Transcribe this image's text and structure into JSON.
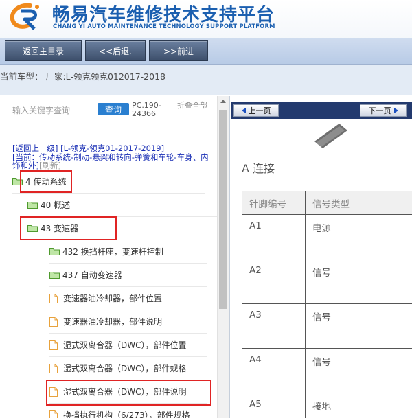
{
  "header": {
    "title_cn": "畅易汽车维修技术支持平台",
    "title_en": "CHANG YI AUTO MAINTENANCE TECHNOLOGY SUPPORT PLATFORM"
  },
  "toolbar": {
    "home_label": "返回主目录",
    "back_label": "<<后退.",
    "forward_label": ">>前进"
  },
  "current_model": "当前车型：  厂家:L-领克领克012017-2018",
  "sidebar": {
    "search_placeholder": "输入关键字查询",
    "search_button": "查询",
    "pc_code": "PC.190-24366",
    "collapse_all": "折叠全部",
    "back_up_link": "[返回上一级]",
    "back_up_model": "[L-领克-领克01-2017-2019]",
    "current_path": "[当前：传动系统-制动-悬架和转向-弹簧和车轮-车身、内饰和外]",
    "refresh": "[刷新]",
    "tree": [
      {
        "label": "4 传动系统",
        "type": "folder"
      },
      {
        "label": "40 概述",
        "type": "folder"
      },
      {
        "label": "43 变速器",
        "type": "folder"
      },
      {
        "label": "432 换挡杆座，变速杆控制",
        "type": "folder"
      },
      {
        "label": "437 自动变速器",
        "type": "folder"
      },
      {
        "label": "变速器油冷却器，部件位置",
        "type": "doc"
      },
      {
        "label": "变速器油冷却器，部件说明",
        "type": "doc"
      },
      {
        "label": "湿式双离合器（DWC），部件位置",
        "type": "doc"
      },
      {
        "label": "湿式双离合器（DWC），部件规格",
        "type": "doc"
      },
      {
        "label": "湿式双离合器（DWC），部件说明",
        "type": "doc"
      },
      {
        "label": "换挡执行机构（6/273），部件规格",
        "type": "doc"
      }
    ]
  },
  "viewer": {
    "prev_page": "上一页",
    "next_page": "下一页",
    "section_title": "A 连接",
    "table_headers": [
      "针脚编号",
      "信号类型"
    ],
    "table_rows": [
      [
        "A1",
        "电源"
      ],
      [
        "A2",
        "信号"
      ],
      [
        "A3",
        "信号"
      ],
      [
        "A4",
        "信号"
      ],
      [
        "A5",
        "接地"
      ]
    ]
  },
  "colors": {
    "brand_blue": "#1b5fb0",
    "highlight_red": "#e02424",
    "folder_green": "#6fbf4a",
    "link_blue": "#1a2fb5"
  }
}
